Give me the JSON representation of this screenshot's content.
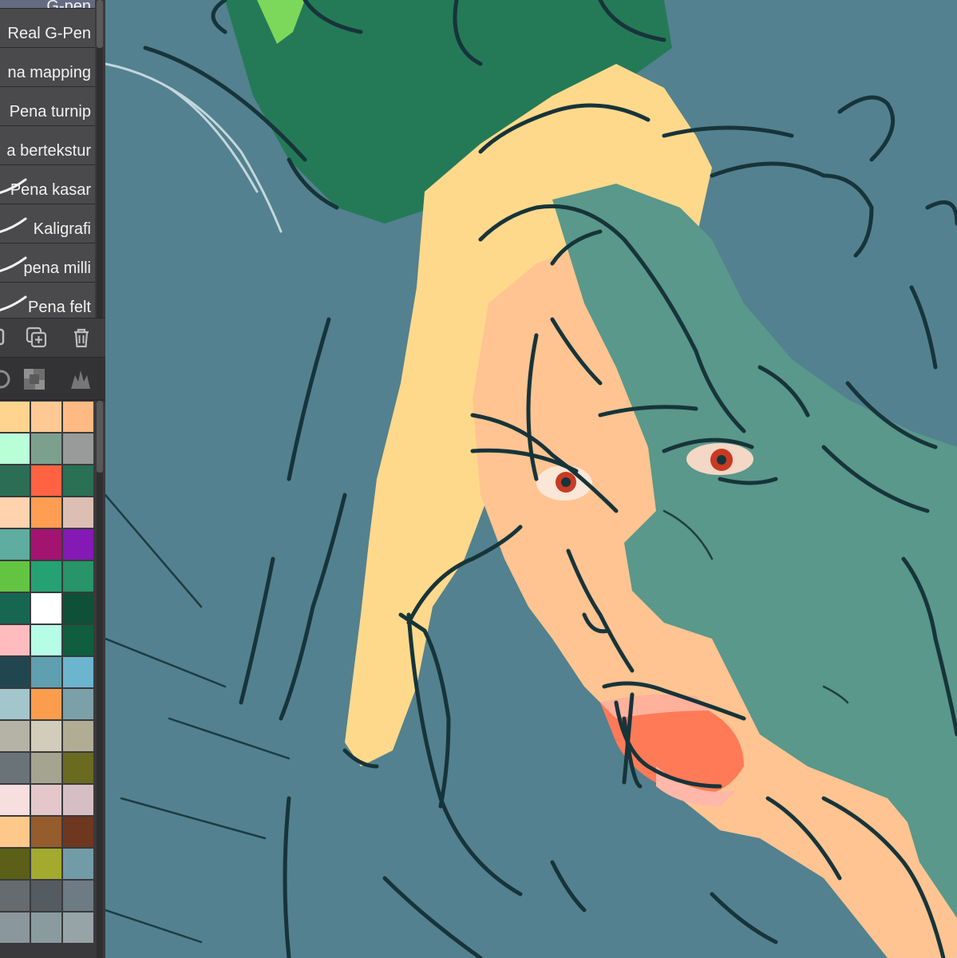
{
  "brushes": [
    {
      "label": "G-pen",
      "selected": true
    },
    {
      "label": "Real G-Pen",
      "selected": false
    },
    {
      "label": "na mapping",
      "selected": false
    },
    {
      "label": "Pena turnip",
      "selected": false
    },
    {
      "label": "a bertekstur",
      "selected": false
    },
    {
      "label": "Pena kasar",
      "selected": false
    },
    {
      "label": "Kaligrafi",
      "selected": false
    },
    {
      "label": "pena milli",
      "selected": false
    },
    {
      "label": "Pena felt",
      "selected": false
    }
  ],
  "palette": [
    [
      "#ffd48f",
      "#ffc996",
      "#ffb982"
    ],
    [
      "#b8ffd8",
      "#7ba18e",
      "#999a9a"
    ],
    [
      "#2b6e55",
      "#ff6342",
      "#2a7055"
    ],
    [
      "#ffd3ad",
      "#ff9d52",
      "#dcbfb2"
    ],
    [
      "#5faca0",
      "#a21470",
      "#8419b5"
    ],
    [
      "#63c442",
      "#26a174",
      "#27946a"
    ],
    [
      "#176651",
      "#ffffff",
      "#0f5038"
    ],
    [
      "#ffbcbf",
      "#b6fde6",
      "#0e5e3f"
    ],
    [
      "#224650",
      "#5f9fb0",
      "#6bb5cf"
    ],
    [
      "#a3c5cc",
      "#fb9d4d",
      "#7ba0a7"
    ],
    [
      "#b4b3a6",
      "#d2cdba",
      "#b0ad94"
    ],
    [
      "#6a7378",
      "#a4a490",
      "#6a6b20"
    ],
    [
      "#f7dedf",
      "#e3c7cb",
      "#d6bfc4"
    ],
    [
      "#fdc88a",
      "#955c2d",
      "#6e3720"
    ],
    [
      "#5b5f18",
      "#a3aa2e",
      "#719ca7"
    ],
    [
      "#656b6e",
      "#545c62",
      "#6d7b84"
    ],
    [
      "#8a979c",
      "#8a9ba0",
      "#96a4a8"
    ]
  ],
  "colors": {
    "canvas_bg": "#53818f",
    "hair_blonde": "#ffd98b",
    "skin": "#ffc491",
    "shadow_teal": "#59988a",
    "hat_green": "#257956",
    "lineart": "#17343a"
  }
}
